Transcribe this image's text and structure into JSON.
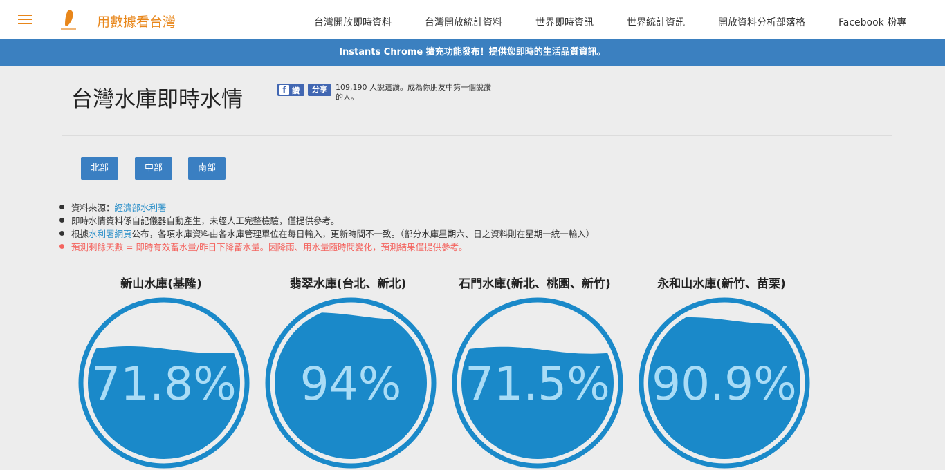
{
  "header": {
    "brand": "用數據看台灣",
    "nav": [
      "台灣開放即時資料",
      "台灣開放統計資料",
      "世界即時資訊",
      "世界統計資訊",
      "開放資料分析部落格",
      "Facebook 粉專"
    ]
  },
  "banner": {
    "text": "Instants Chrome 擴充功能發布！提供您即時的生活品質資訊。"
  },
  "page": {
    "title": "台灣水庫即時水情"
  },
  "facebook": {
    "like_label": "讚",
    "share_label": "分享",
    "count_text": "109,190 人說這讚。成為你朋友中第一個說讚的人。"
  },
  "regions": [
    "北部",
    "中部",
    "南部"
  ],
  "notes": {
    "source_prefix": "資料來源：",
    "source_link": "經濟部水利署",
    "auto_text": "即時水情資料係自記儀器自動產生，未經人工完整檢驗，僅提供參考。",
    "publish_prefix": "根據",
    "publish_link": "水利署網頁",
    "publish_suffix": "公布，各項水庫資料由各水庫管理單位在每日輸入，更新時間不一致。（部分水庫星期六、日之資料則在星期一統一輸入）",
    "forecast_text": "預測剩餘天數 = 即時有效蓄水量/昨日下降蓄水量。因降雨、用水量隨時間變化，預測結果僅提供參考。"
  },
  "reservoirs": [
    {
      "name": "新山水庫(基隆)",
      "percent_label": "71.8%",
      "fill": 0.718
    },
    {
      "name": "翡翠水庫(台北、新北)",
      "percent_label": "94%",
      "fill": 0.94
    },
    {
      "name": "石門水庫(新北、桃園、新竹)",
      "percent_label": "71.5%",
      "fill": 0.715
    },
    {
      "name": "永和山水庫(新竹、苗栗)",
      "percent_label": "90.9%",
      "fill": 0.909
    }
  ],
  "colors": {
    "accent": "#e8861a",
    "banner": "#3b80c0",
    "button": "#3a7fc2",
    "water": "#1a89c9",
    "water_text": "#a9dcf6",
    "warning": "#f4645f"
  }
}
